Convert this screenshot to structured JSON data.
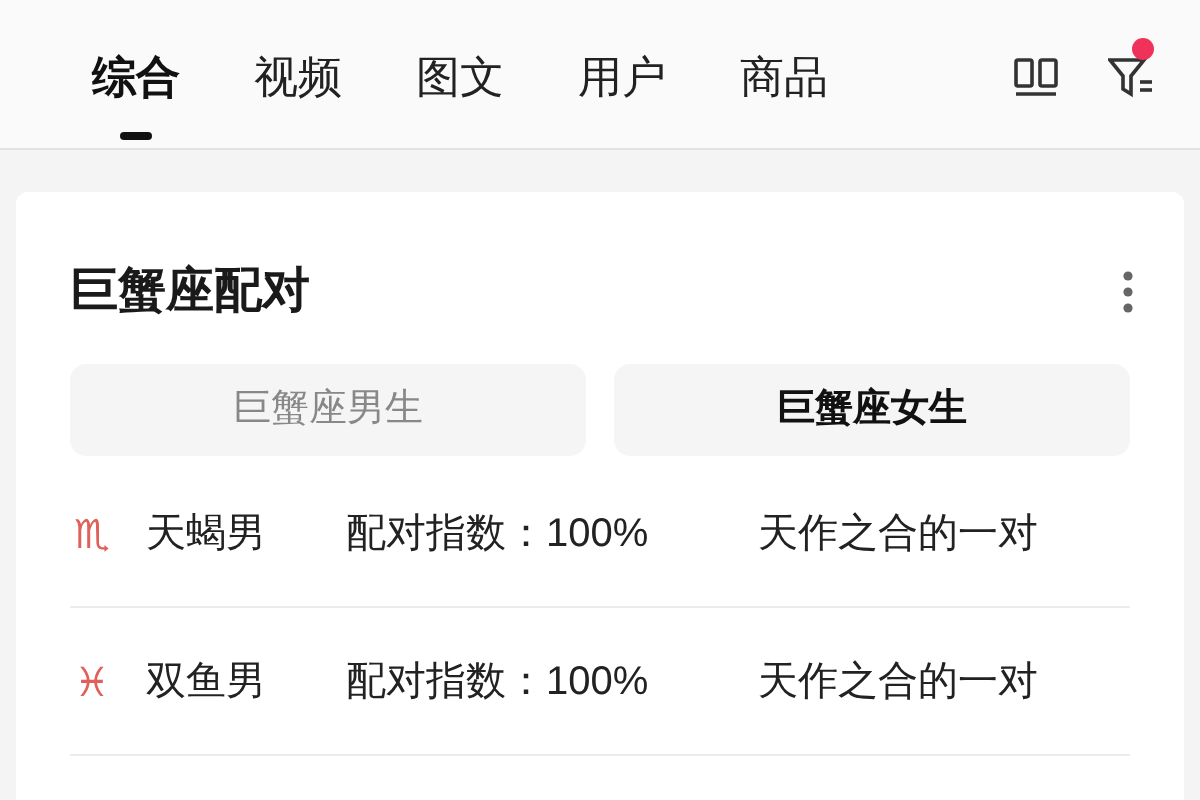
{
  "tabs": [
    {
      "label": "综合",
      "selected": true
    },
    {
      "label": "视频",
      "selected": false
    },
    {
      "label": "图文",
      "selected": false
    },
    {
      "label": "用户",
      "selected": false
    },
    {
      "label": "商品",
      "selected": false
    }
  ],
  "filter": {
    "has_notification": true
  },
  "card": {
    "title": "巨蟹座配对",
    "segments": [
      {
        "label": "巨蟹座男生",
        "selected": false
      },
      {
        "label": "巨蟹座女生",
        "selected": true
      }
    ],
    "rows": [
      {
        "sign": "♏",
        "name": "天蝎男",
        "score": "配对指数：100%",
        "verdict": "天作之合的一对"
      },
      {
        "sign": "♓",
        "name": "双鱼男",
        "score": "配对指数：100%",
        "verdict": "天作之合的一对"
      }
    ]
  }
}
